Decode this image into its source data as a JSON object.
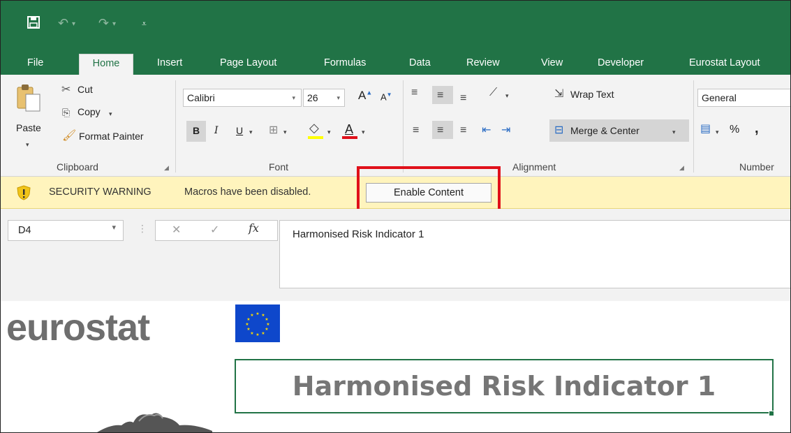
{
  "quick_access": {
    "save_icon": "save-icon",
    "undo_icon": "undo-icon",
    "redo_icon": "redo-icon",
    "customize_icon": "customize-qat-icon"
  },
  "tabs": [
    "File",
    "Home",
    "Insert",
    "Page Layout",
    "Formulas",
    "Data",
    "Review",
    "View",
    "Developer",
    "Eurostat Layout"
  ],
  "active_tab": "Home",
  "ribbon": {
    "clipboard": {
      "paste": "Paste",
      "cut": "Cut",
      "copy": "Copy",
      "format_painter": "Format Painter",
      "label": "Clipboard"
    },
    "font": {
      "name": "Calibri",
      "size": "26",
      "bold": "B",
      "italic": "I",
      "underline": "U",
      "font_color_letter": "A",
      "label": "Font"
    },
    "alignment": {
      "wrap_text": "Wrap Text",
      "merge_center": "Merge & Center",
      "label": "Alignment"
    },
    "number": {
      "format": "General",
      "percent": "%",
      "comma": ",",
      "label": "Number"
    }
  },
  "security_bar": {
    "title": "SECURITY WARNING",
    "message": "Macros have been disabled.",
    "button": "Enable Content"
  },
  "formula_bar": {
    "name_box": "D4",
    "formula": "Harmonised Risk Indicator 1"
  },
  "sheet": {
    "logo_text": "eurostat",
    "cell_title": "Harmonised Risk Indicator 1"
  },
  "colors": {
    "excel_green": "#217346",
    "warning_bar": "#fff4bd",
    "highlight_red": "#e0101a",
    "eu_blue": "#0e47cb",
    "eu_star": "#ffdd00"
  }
}
